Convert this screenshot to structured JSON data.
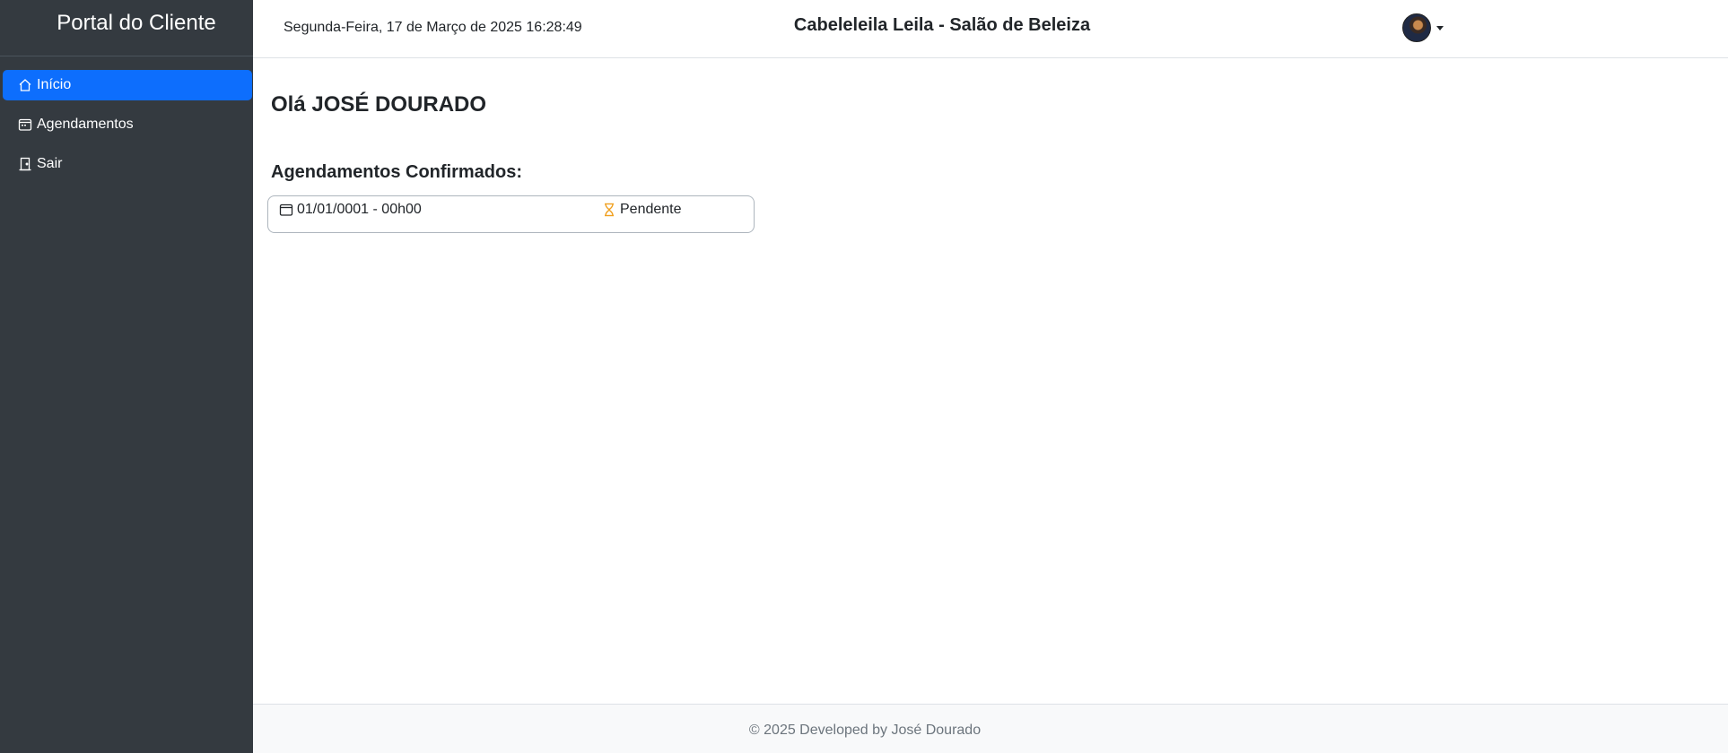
{
  "sidebar": {
    "brand": "Portal do Cliente",
    "items": [
      {
        "label": "Início",
        "icon": "house-icon",
        "active": true
      },
      {
        "label": "Agendamentos",
        "icon": "calendar-week-icon",
        "active": false
      },
      {
        "label": "Sair",
        "icon": "door-icon",
        "active": false
      }
    ]
  },
  "header": {
    "datetime": "Segunda-Feira, 17 de Março de 2025 16:28:49",
    "title": "Cabeleleila Leila - Salão de Beleiza",
    "user_avatar": "avatar",
    "user_menu_icon": "caret-down-icon"
  },
  "main": {
    "greeting": "Olá JOSÉ DOURADO",
    "section_title": "Agendamentos Confirmados:",
    "appointments": [
      {
        "datetime": "01/01/0001 - 00h00",
        "status": "Pendente",
        "date_icon": "calendar-icon",
        "status_icon": "hourglass-icon",
        "status_color": "#f0a020"
      }
    ]
  },
  "footer": {
    "text": "© 2025 Developed by José Dourado"
  },
  "colors": {
    "sidebar_bg": "#343a40",
    "accent": "#0d6efd",
    "footer_bg": "#f8f9fa"
  }
}
